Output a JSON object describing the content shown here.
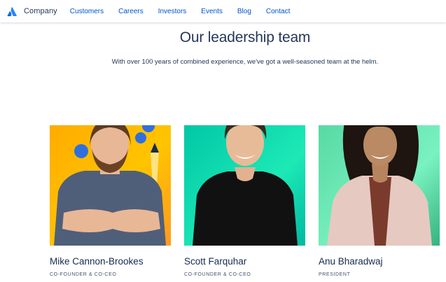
{
  "nav": {
    "brand": "Company",
    "links": [
      "Customers",
      "Careers",
      "Investors",
      "Events",
      "Blog",
      "Contact"
    ]
  },
  "page": {
    "title": "Our leadership team",
    "subtitle": "With over 100 years of combined experience, we've got a well-seasoned team at the helm."
  },
  "leaders": [
    {
      "name": "Mike Cannon-Brookes",
      "role": "CO-FOUNDER & CO-CEO"
    },
    {
      "name": "Scott Farquhar",
      "role": "CO-FOUNDER & CO-CEO"
    },
    {
      "name": "Anu Bharadwaj",
      "role": "PRESIDENT"
    }
  ],
  "colors": {
    "brand_blue": "#0052cc",
    "heading": "#253858",
    "card_bg_1": "#ffab00",
    "card_bg_2": "#1de9b6",
    "card_bg_3": "#79f2c0"
  },
  "icons": {
    "logo": "atlassian-logo-icon"
  }
}
